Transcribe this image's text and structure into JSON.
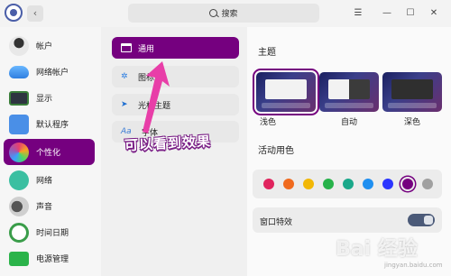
{
  "titlebar": {
    "search_placeholder": "搜索",
    "back_icon": "chevron-left-icon",
    "menu_icon": "☰",
    "minimize_icon": "—",
    "maximize_icon": "☐",
    "close_icon": "✕"
  },
  "sidebar": {
    "items": [
      {
        "label": "帐户",
        "icon": "user-icon"
      },
      {
        "label": "网络帐户",
        "icon": "cloud-icon"
      },
      {
        "label": "显示",
        "icon": "monitor-icon"
      },
      {
        "label": "默认程序",
        "icon": "check-list-icon"
      },
      {
        "label": "个性化",
        "icon": "palette-icon",
        "active": true
      },
      {
        "label": "网络",
        "icon": "network-icon"
      },
      {
        "label": "声音",
        "icon": "speaker-icon"
      },
      {
        "label": "时间日期",
        "icon": "clock-icon"
      },
      {
        "label": "电源管理",
        "icon": "battery-icon"
      }
    ]
  },
  "submenu": {
    "items": [
      {
        "label": "通用",
        "icon": "window-icon",
        "active": true
      },
      {
        "label": "图标主",
        "icon": "snowflake-icon"
      },
      {
        "label": "光标主题",
        "icon": "cursor-icon"
      },
      {
        "label": "字体",
        "icon": "font-icon",
        "glyph": "Aa"
      }
    ]
  },
  "general": {
    "theme_title": "主题",
    "themes": [
      {
        "label": "浅色",
        "selected": true
      },
      {
        "label": "自动",
        "selected": false
      },
      {
        "label": "深色",
        "selected": false
      }
    ],
    "accent_title": "活动用色",
    "accent_colors": [
      "#e0245e",
      "#f06a1e",
      "#f2b705",
      "#27b24a",
      "#1aa88a",
      "#1f8ff0",
      "#2b35ff",
      "#75007f",
      "#a0a0a0"
    ],
    "accent_selected_index": 7,
    "window_effect_label": "窗口特效",
    "window_effect_on": true
  },
  "annotation": {
    "text": "可以看到效果"
  },
  "watermark": {
    "text": "Bai 经验",
    "sub": "jingyan.baidu.com"
  },
  "colors": {
    "accent": "#75007f"
  }
}
